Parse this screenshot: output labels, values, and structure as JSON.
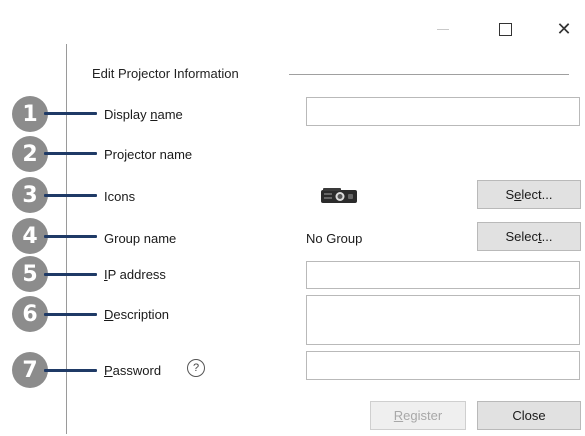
{
  "window": {
    "minimize_icon": "minimize-icon",
    "maximize_icon": "maximize-icon",
    "close_glyph": "✕"
  },
  "group": {
    "title": "Edit Projector Information"
  },
  "callouts": [
    "1",
    "2",
    "3",
    "4",
    "5",
    "6",
    "7"
  ],
  "fields": {
    "display_name": {
      "label_pre": "Display ",
      "label_access": "n",
      "label_post": "ame",
      "value": ""
    },
    "projector_name": {
      "label": "Projector name"
    },
    "icons": {
      "label": "Icons",
      "icon": "projector-icon",
      "button_pre": "S",
      "button_access": "e",
      "button_post": "lect..."
    },
    "group_name": {
      "label": "Group name",
      "value": "No Group",
      "button_pre": "Selec",
      "button_access": "t",
      "button_post": "..."
    },
    "ip_address": {
      "label_access": "I",
      "label_post": "P address",
      "value": ""
    },
    "description": {
      "label_access": "D",
      "label_post": "escription",
      "value": ""
    },
    "password": {
      "label_access": "P",
      "label_post": "assword",
      "help_glyph": "?",
      "value": ""
    }
  },
  "buttons": {
    "register_access": "R",
    "register_post": "egister",
    "close": "Close"
  },
  "colors": {
    "callout": "#8c8c8c",
    "leader": "#1f3a66",
    "button": "#e1e1e1"
  }
}
